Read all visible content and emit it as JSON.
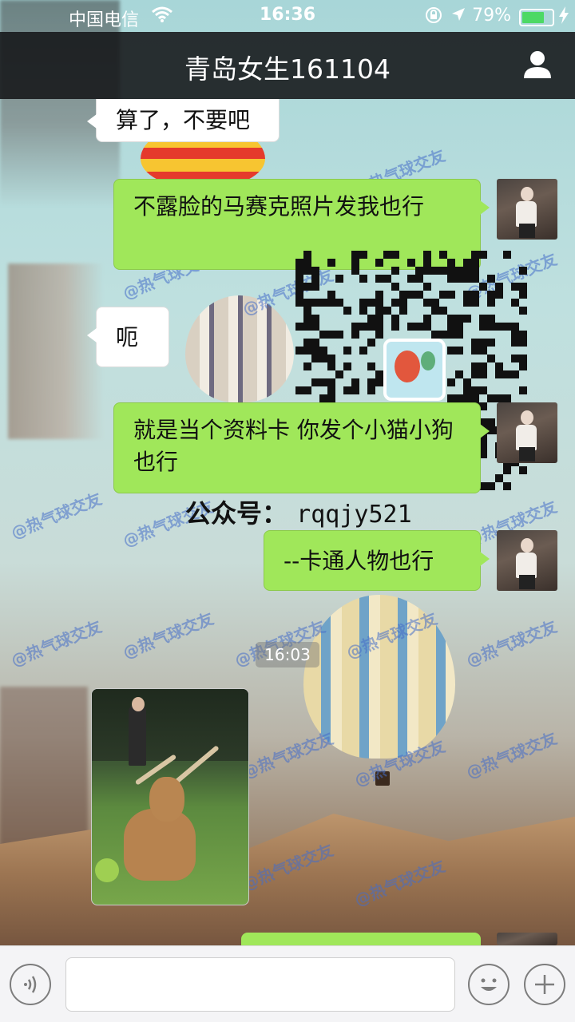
{
  "status_bar": {
    "carrier": "中国电信",
    "time": "16:36",
    "battery_percent": "79%",
    "battery_level": 0.79,
    "icons": [
      "wifi-icon",
      "orientation-lock-icon",
      "location-arrow-icon",
      "battery-icon",
      "charging-bolt-icon"
    ]
  },
  "nav": {
    "title": "青岛女生161104",
    "profile_icon": "person-icon"
  },
  "messages": [
    {
      "side": "left",
      "text": "算了，不要吧"
    },
    {
      "side": "right",
      "text": "不露脸的马赛克照片发我也行"
    },
    {
      "side": "left",
      "text": "呃"
    },
    {
      "side": "right",
      "text": "就是当个资料卡  你发个小猫小狗也行"
    },
    {
      "side": "right",
      "text": "--卡通人物也行"
    }
  ],
  "timestamp": "16:03",
  "watermark": {
    "text": "@热气球交友",
    "public_account_label": "公众号：",
    "public_account_id": "rqqjy521"
  },
  "input_bar": {
    "voice_icon": "voice-icon",
    "emoji_icon": "emoji-icon",
    "plus_icon": "plus-icon"
  },
  "colors": {
    "bubble_green": "#a0e75a",
    "nav_bg": "#141618",
    "battery_green": "#4cd964"
  }
}
